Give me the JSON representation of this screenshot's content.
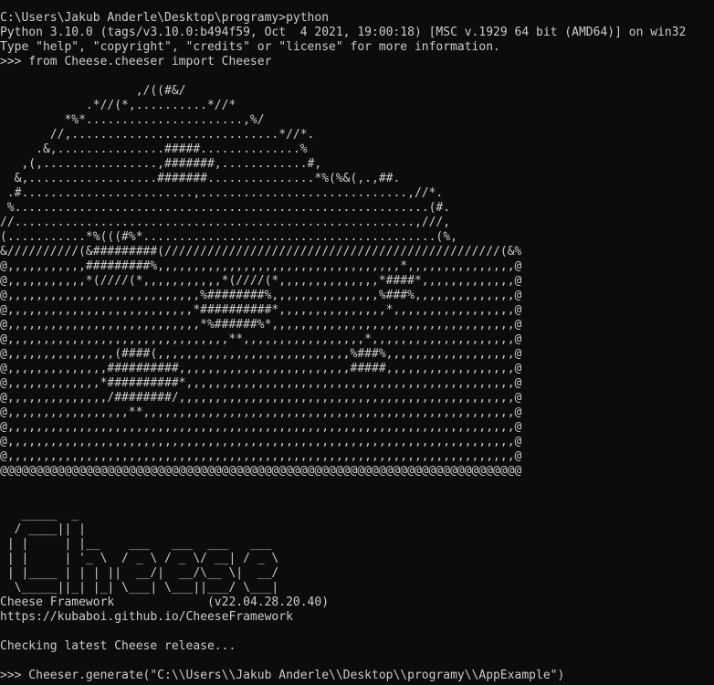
{
  "terminal": {
    "cwd_prompt": "C:\\Users\\Jakub Anderle\\Desktop\\programy>python",
    "python_banner_1": "Python 3.10.0 (tags/v3.10.0:b494f59, Oct  4 2021, 19:00:18) [MSC v.1929 64 bit (AMD64)] on win32",
    "python_banner_2": "Type \"help\", \"copyright\", \"credits\" or \"license\" for more information.",
    "import_cmd": ">>> from Cheese.cheeser import Cheeser",
    "cheese_art": [
      "",
      "                   ,/((#&/",
      "            .*//(*,..........*//*",
      "         *%*......................,%/",
      "       //,.............................*//*.",
      "     .&,...............#####..............%",
      "   ,(,................,#######,............#,",
      "  &,..................#######...............*%(%&(,.,##.",
      " .#........................,.............................,//*.",
      " %..........................................................(#.",
      "//........................................................,///,",
      "(...........*%(((#%*.........................................(%,",
      "&//////////(&#########(///////////////////////////////////////////////(&%",
      "@,,,,,,,,,,,#########%,,,,,,,,,,,,,,,,,,,,,,,,,,,,,,,,,,*,,,,,,,,,,,,,,,@",
      "@,,,,,,,,,,,*(////(*,,,,,,,,,,,*(////(*,,,,,,,,,,,,,,*####*,,,,,,,,,,,,,@",
      "@,,,,,,,,,,,,,,,,,,,,,,,,,,,%########%,,,,,,,,,,,,,,,%###%,,,,,,,,,,,,,,@",
      "@,,,,,,,,,,,,,,,,,,,,,,,,,,*##########*,,,,,,,,,,,,,,,*,,,,,,,,,,,,,,,,,@",
      "@,,,,,,,,,,,,,,,,,,,,,,,,,,,*%######%*,,,,,,,,,,,,,,,,,,,,,,,,,,,,,,,,,,@",
      "@,,,,,,,,,,,,,,,,,,,,,,,,,,,,,,,**,,,,,,,,,,,,,,,,,*,,,,,,,,,,,,,,,,,,,,@",
      "@,,,,,,,,,,,,,,,(####(,,,,,,,,,,,,,,,,,,,,,,,,,,,%###%,,,,,,,,,,,,,,,,,,@",
      "@,,,,,,,,,,,,,,##########,,,,,,,,,,,,,,,,,,,,,,,,#####,,,,,,,,,,,,,,,,,,@",
      "@,,,,,,,,,,,,,*##########*,,,,,,,,,,,,,,,,,,,,,,,,,,,,,,,,,,,,,,,,,,,,,,@",
      "@,,,,,,,,,,,,,,/########/,,,,,,,,,,,,,,,,,,,,,,,,,,,,,,,,,,,,,,,,,,,,,,,@",
      "@,,,,,,,,,,,,,,,,,**,,,,,,,,,,,,,,,,,,,,,,,,,,,,,,,,,,,,,,,,,,,,,,,,,,,,@",
      "@,,,,,,,,,,,,,,,,,,,,,,,,,,,,,,,,,,,,,,,,,,,,,,,,,,,,,,,,,,,,,,,,,,,,,,,@",
      "@,,,,,,,,,,,,,,,,,,,,,,,,,,,,,,,,,,,,,,,,,,,,,,,,,,,,,,,,,,,,,,,,,,,,,,,@",
      "@,,,,,,,,,,,,,,,,,,,,,,,,,,,,,,,,,,,,,,,,,,,,,,,,,,,,,,,,,,,,,,,,,,,,,,,@",
      "@@@@@@@@@@@@@@@@@@@@@@@@@@@@@@@@@@@@@@@@@@@@@@@@@@@@@@@@@@@@@@@@@@@@@@@@@",
      "",
      "",
      "   _____  _",
      "  / ____|| |",
      " | |     | |__    ___   ___  ___   ___",
      " | |     | '_ \\  / _ \\ / _ \\/ __| / _ \\",
      " | |____ | | | ||  __/|  __/\\__ \\|  __/",
      "  \\_____||_| |_| \\___| \\___||___/ \\___|"
    ],
    "framework_name": "Cheese Framework",
    "framework_version": "(v22.04.28.20.40)",
    "framework_url": "https://kubaboi.github.io/CheeseFramework",
    "checking_text": "Checking latest Cheese release...",
    "generate_cmd": ">>> Cheeser.generate(\"C:\\\\Users\\\\Jakub Anderle\\\\Desktop\\\\programy\\\\AppExample\")",
    "final_prompt": ">>> ",
    "colors": {
      "background": "#0c0c0c",
      "foreground": "#cccccc"
    }
  }
}
